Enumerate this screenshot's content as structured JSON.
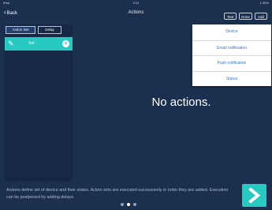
{
  "status_bar": {
    "carrier": "iPad",
    "time": "3:12",
    "battery": "1 55%"
  },
  "navbar": {
    "back_label": "Back",
    "title": "Actions",
    "buttons": {
      "test": "Test",
      "done": "Done",
      "add": "Add"
    }
  },
  "sidebar": {
    "segments": {
      "action_set": "Action Set",
      "delay": "Delay"
    },
    "items": [
      {
        "label": "Set"
      }
    ]
  },
  "main": {
    "empty_message": "No actions."
  },
  "add_menu": {
    "items": [
      {
        "label": "Device"
      },
      {
        "label": "Email notification"
      },
      {
        "label": "Push notification"
      },
      {
        "label": "Status"
      }
    ]
  },
  "footer": {
    "description": "Actions define set of device and their states. Action sets are executed successively in order they are added. Execution can be postponed by adding delays.",
    "page_count": 3,
    "active_page": 2
  },
  "colors": {
    "background": "#1b2f4f",
    "accent": "#28c9c0",
    "menu_text": "#3b73c4"
  },
  "icons": {
    "back": "chevron-left-icon",
    "edit": "pencil-icon",
    "remove": "close-circle-icon",
    "next": "chevron-right-icon"
  }
}
